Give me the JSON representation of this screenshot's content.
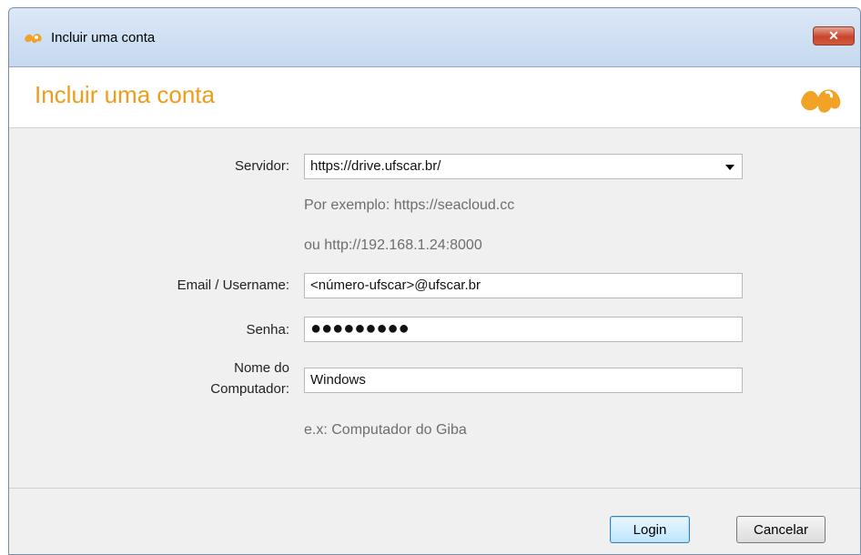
{
  "window": {
    "title": "Incluir uma conta",
    "close_label": "✕"
  },
  "header": {
    "title": "Incluir uma conta"
  },
  "form": {
    "server": {
      "label": "Servidor:",
      "value": "https://drive.ufscar.br/",
      "hint_1": "Por exemplo: https://seacloud.cc",
      "hint_2": "ou http://192.168.1.24:8000"
    },
    "email": {
      "label": "Email / Username:",
      "value": "<número-ufscar>@ufscar.br"
    },
    "password": {
      "label": "Senha:",
      "value": "●●●●●●●●●"
    },
    "computer": {
      "label_line1": "Nome do",
      "label_line2": "Computador:",
      "value": "Windows",
      "hint": "e.x: Computador do Giba"
    }
  },
  "buttons": {
    "login": "Login",
    "cancel": "Cancelar"
  },
  "colors": {
    "accent": "#ed9d1b"
  }
}
